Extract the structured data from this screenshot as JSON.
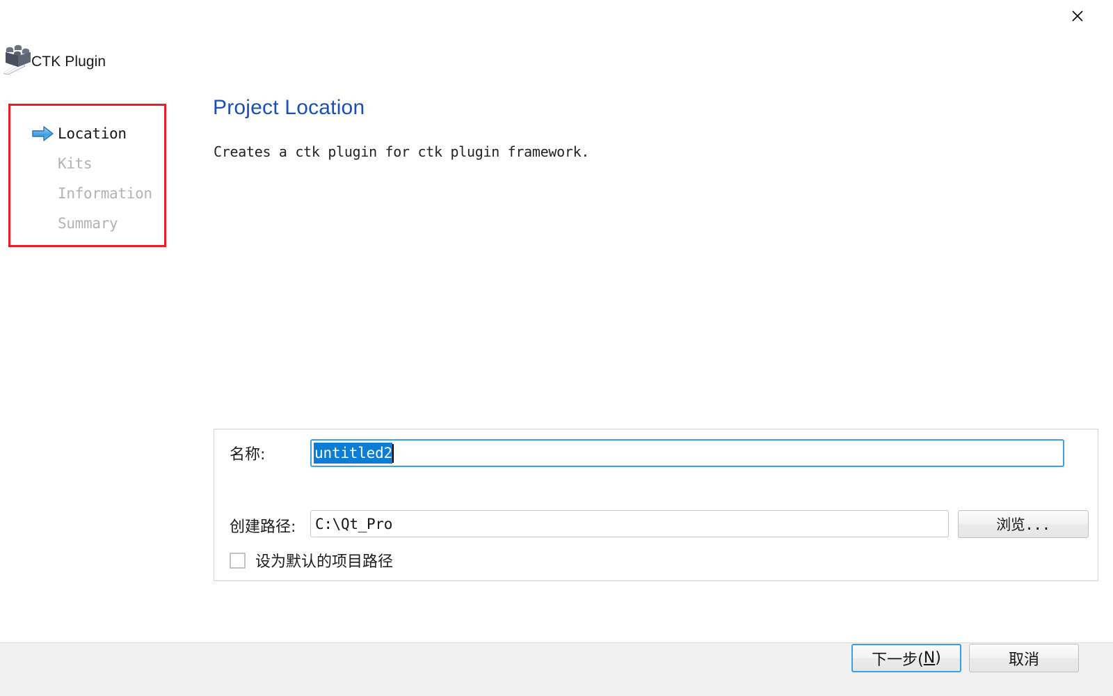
{
  "window": {
    "close_icon": "close-icon",
    "app_logo_icon": "ctk-plugin-brick-logo",
    "header_title": "CTK Plugin"
  },
  "sidebar": {
    "items": [
      {
        "label": "Location",
        "state": "active",
        "icon": "blue-right-arrow-icon"
      },
      {
        "label": "Kits",
        "state": "inactive",
        "icon": ""
      },
      {
        "label": "Information",
        "state": "inactive",
        "icon": ""
      },
      {
        "label": "Summary",
        "state": "inactive",
        "icon": ""
      }
    ],
    "annotation_color": "#ed1c24"
  },
  "main": {
    "title": "Project Location",
    "description": "Creates a ctk plugin for ctk plugin framework.",
    "title_color": "#1a4fba"
  },
  "form": {
    "name_label": "名称:",
    "name_value": "untitled2",
    "name_selected": true,
    "name_selection_color": "#0c7cd5",
    "name_focus_border_color": "#3aa0e8",
    "path_label": "创建路径:",
    "path_value": "C:\\Qt_Pro",
    "browse_label": "浏览...",
    "default_path_checkbox_label": "设为默认的项目路径",
    "default_path_checked": false
  },
  "footer": {
    "next_label_text": "下一步(",
    "next_mnemonic": "N",
    "next_label_tail": ")",
    "cancel_label": "取消",
    "next_focus_color": "#3aa0e8",
    "background": "#f0f0f0"
  }
}
